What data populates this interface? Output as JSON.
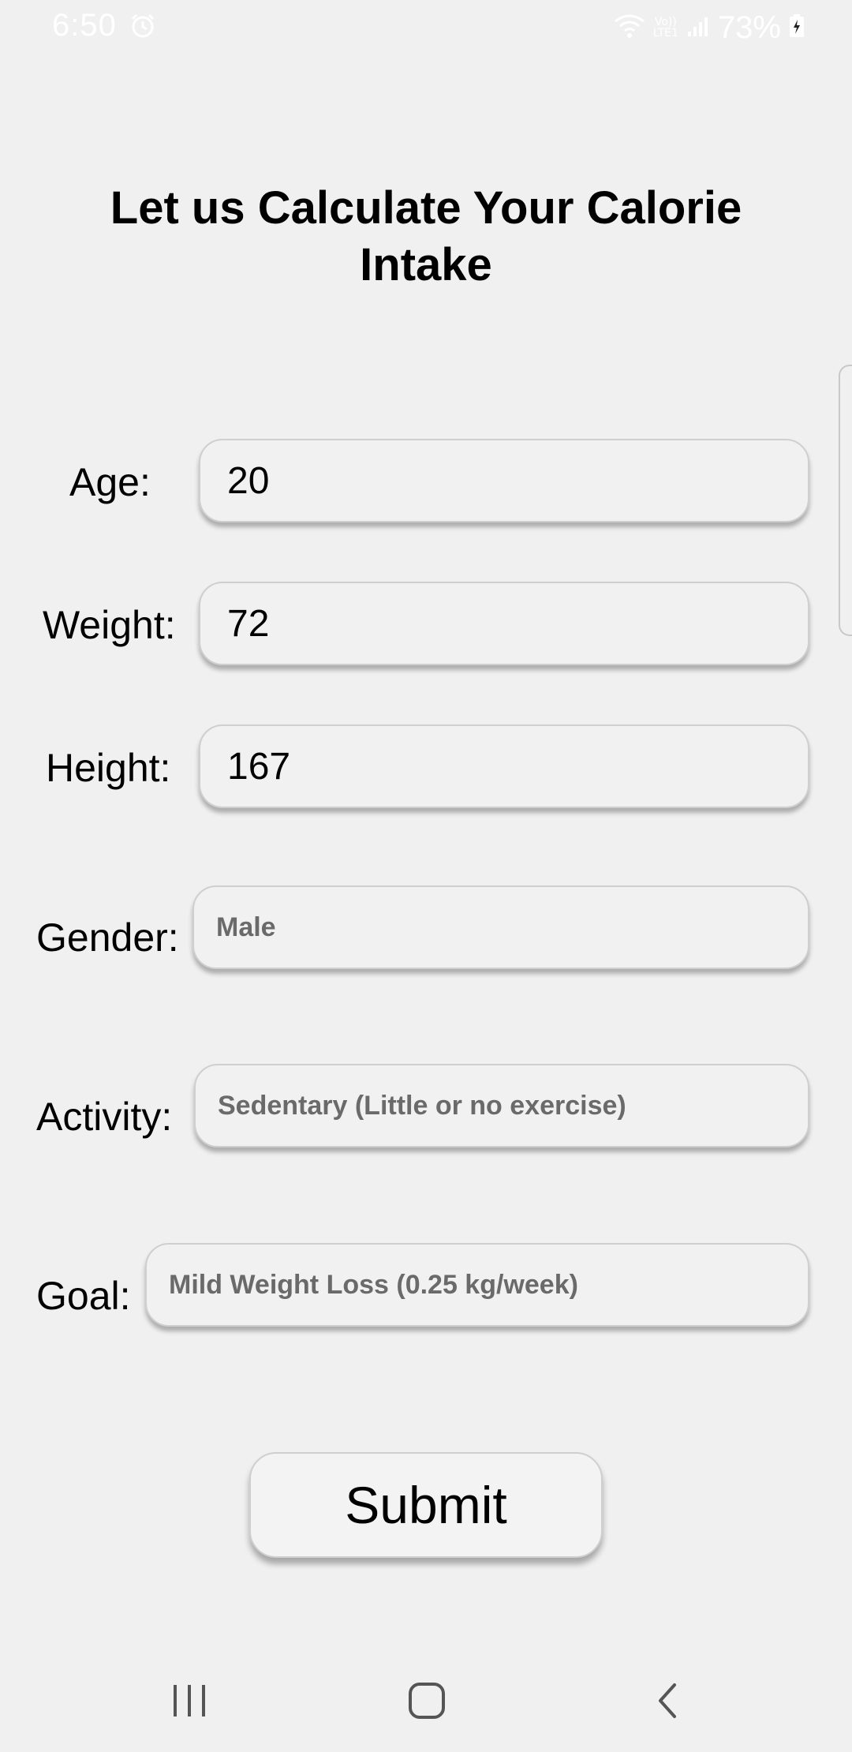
{
  "status_bar": {
    "time": "6:50",
    "lte_label_top": "Vo))",
    "lte_label_bottom": "LTE1",
    "battery": "73%",
    "icons": [
      "alarm-icon",
      "wifi-icon",
      "lte-icon",
      "signal-icon",
      "battery-charging-icon"
    ]
  },
  "page": {
    "title": "Let us Calculate Your Calorie Intake"
  },
  "form": {
    "age": {
      "label": "Age:",
      "value": "20"
    },
    "weight": {
      "label": "Weight:",
      "value": "72"
    },
    "height": {
      "label": "Height:",
      "value": "167"
    },
    "gender": {
      "label": "Gender:",
      "selected": "Male"
    },
    "activity": {
      "label": "Activity:",
      "selected": "Sedentary (Little or no exercise)"
    },
    "goal": {
      "label": "Goal:",
      "selected": "Mild Weight Loss (0.25 kg/week)"
    },
    "submit_label": "Submit"
  },
  "nav_bar": {
    "icons": [
      "recent-apps-icon",
      "home-icon",
      "back-icon"
    ]
  },
  "colors": {
    "background": "#f0f0f0",
    "select_text": "#6a6a6a",
    "field_border": "#cfcfcf"
  }
}
